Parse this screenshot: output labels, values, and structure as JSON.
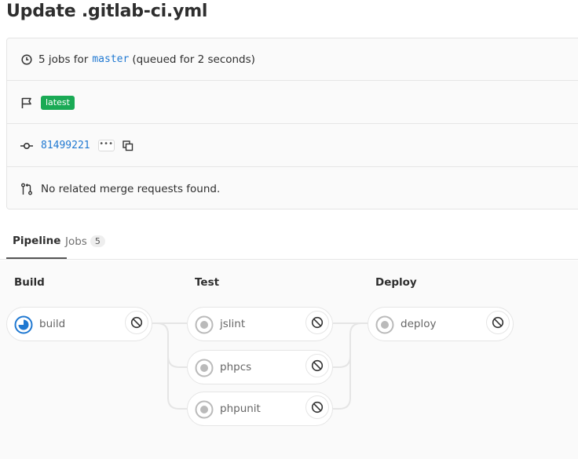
{
  "header": {
    "title": "Update .gitlab-ci.yml"
  },
  "info": {
    "jobs_prefix": "5 jobs for",
    "branch": "master",
    "queued": "(queued for 2 seconds)",
    "badge": "latest",
    "commit_sha": "81499221",
    "ellipsis": "•••",
    "merge_requests": "No related merge requests found."
  },
  "tabs": {
    "pipeline": "Pipeline",
    "jobs": "Jobs",
    "jobs_count": "5"
  },
  "stages": [
    {
      "name": "Build",
      "jobs": [
        {
          "name": "build",
          "status": "running"
        }
      ]
    },
    {
      "name": "Test",
      "jobs": [
        {
          "name": "jslint",
          "status": "created"
        },
        {
          "name": "phpcs",
          "status": "created"
        },
        {
          "name": "phpunit",
          "status": "created"
        }
      ]
    },
    {
      "name": "Deploy",
      "jobs": [
        {
          "name": "deploy",
          "status": "created"
        }
      ]
    }
  ],
  "icons": {
    "clock": "clock-icon",
    "flag": "flag-icon",
    "commit": "commit-icon",
    "copy": "copy-icon",
    "merge_request": "merge-request-icon",
    "cancel": "cancel-icon",
    "status_running": "status-running-icon",
    "status_created": "status-created-icon"
  },
  "colors": {
    "link": "#1f78d1",
    "badge_green": "#1aaa55",
    "running_blue": "#1f78d1",
    "created_gray": "#bababa"
  }
}
